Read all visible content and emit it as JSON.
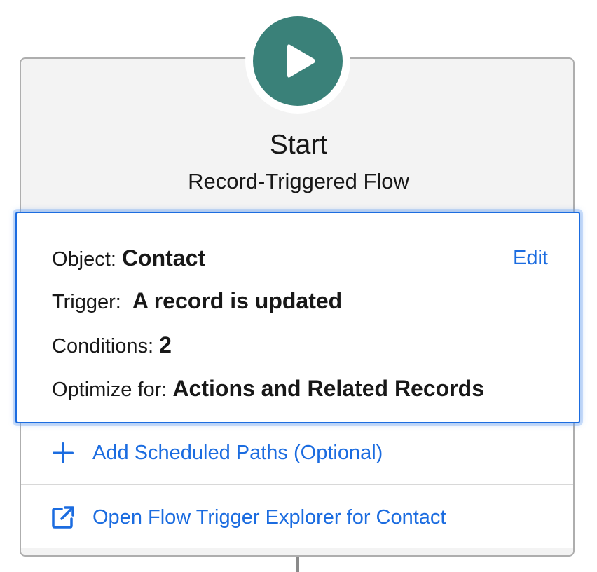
{
  "start": {
    "title": "Start",
    "subtitle": "Record-Triggered Flow",
    "icon": "play-icon",
    "icon_color": "#3a8179"
  },
  "details": {
    "object_label": "Object:",
    "object_value": "Contact",
    "edit_label": "Edit",
    "trigger_label": "Trigger:",
    "trigger_value": "A record is updated",
    "conditions_label": "Conditions:",
    "conditions_value": "2",
    "optimize_label": "Optimize for:",
    "optimize_value": "Actions and Related Records",
    "selection_color": "#1b6ce0"
  },
  "actions": [
    {
      "icon": "plus-icon",
      "label": "Add Scheduled Paths (Optional)"
    },
    {
      "icon": "new-window-icon",
      "label": "Open Flow Trigger Explorer for Contact"
    }
  ],
  "colors": {
    "link": "#1b6ce0",
    "header_bg": "#f3f3f3",
    "card_border": "#aeaeae"
  }
}
